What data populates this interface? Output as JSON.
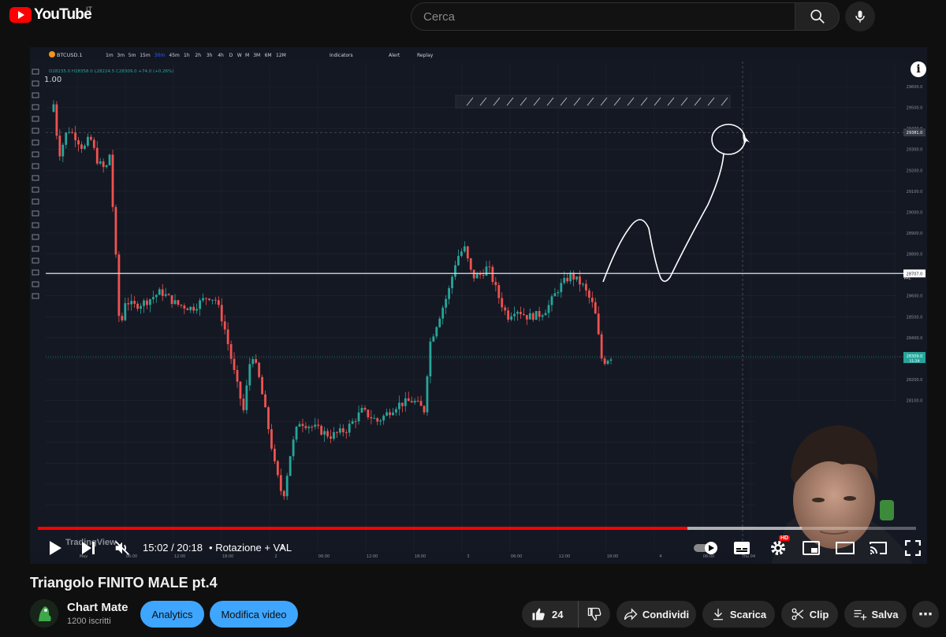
{
  "topbar": {
    "logo_text": "YouTube",
    "country_code": "IT",
    "search_placeholder": "Cerca"
  },
  "player": {
    "current_time": "15:02",
    "separator": "/",
    "duration": "20:18",
    "chapter_prefix": "•",
    "chapter": "Rotazione + VAL",
    "watermark": "TradingView",
    "progress_fraction": 0.74,
    "buffered_fraction": 0.87,
    "info_icon": "i",
    "hd_badge": "HD",
    "chart": {
      "symbol": "BTCUSD.1",
      "timeframes": [
        "1m",
        "3m",
        "5m",
        "15m",
        "30m",
        "45m",
        "1h",
        "2h",
        "3h",
        "4h",
        "D",
        "W",
        "M",
        "3M",
        "6M",
        "12M"
      ],
      "active_timeframe": "30m",
      "toolbar_items": [
        "Indicators",
        "Alert",
        "Replay"
      ],
      "ohlc": "O28235.0 H28358.0 L28224.5 C28309.0 +74.0 (+0.26%)",
      "zoom_label": "1.00",
      "price_ticks": [
        "29600.0",
        "29500.0",
        "29400.0",
        "29300.0",
        "29200.0",
        "29100.0",
        "29000.0",
        "28900.0",
        "28800.0",
        "28700.0",
        "28600.0",
        "28500.0",
        "28400.0",
        "28300.0",
        "28200.0",
        "28100.0",
        "28000.0",
        "27900.0",
        "27800.0",
        "27700.0",
        "27600.0",
        "27500.0"
      ],
      "crosshair_price": "29381.0",
      "val_price": "28707.0",
      "val_label": "VAL",
      "last_price": "28309.0",
      "last_price_countdown": "11:29",
      "time_ticks": [
        "May",
        "06:00",
        "12:00",
        "18:00",
        "2",
        "06:00",
        "12:00",
        "18:00",
        "3",
        "06:00",
        "12:00",
        "18:00",
        "4",
        "06:00",
        "Thu 04 May '23"
      ]
    }
  },
  "video": {
    "title": "Triangolo FINITO MALE pt.4"
  },
  "channel": {
    "name": "Chart Mate",
    "subscribers": "1200 iscritti"
  },
  "actions": {
    "analytics": "Analytics",
    "edit_video": "Modifica video",
    "like_count": "24",
    "share": "Condividi",
    "download": "Scarica",
    "clip": "Clip",
    "save": "Salva"
  },
  "colors": {
    "brand_red": "#ff0000",
    "accent_blue": "#3ea6ff",
    "candle_up": "#26a69a",
    "candle_down": "#ef5350",
    "chart_bg": "#141823"
  }
}
